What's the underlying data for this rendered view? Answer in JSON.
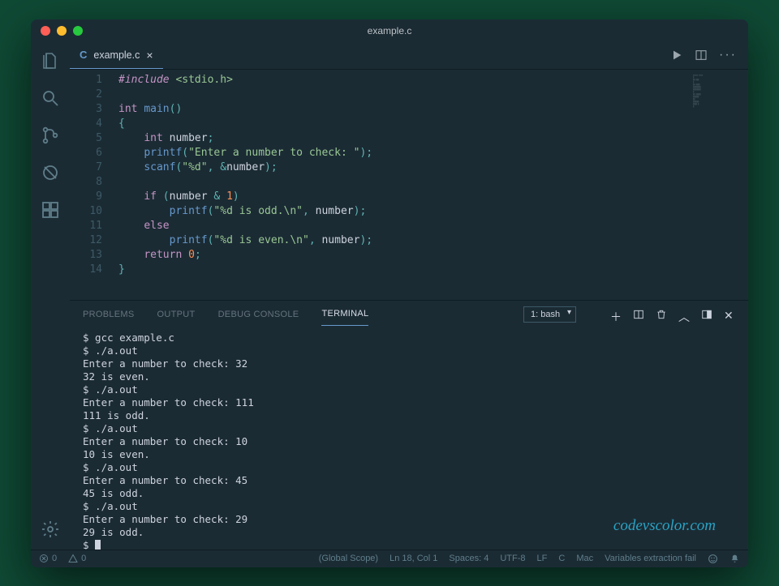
{
  "window": {
    "title": "example.c"
  },
  "tab": {
    "filename": "example.c",
    "lang_badge": "C"
  },
  "code": {
    "lines": [
      {
        "n": 1,
        "html": "<span class='tok-preproc'>#include</span> <span class='tok-include'>&lt;stdio.h&gt;</span>"
      },
      {
        "n": 2,
        "html": ""
      },
      {
        "n": 3,
        "html": "<span class='tok-type'>int</span> <span class='tok-func'>main</span><span class='tok-punc'>()</span>"
      },
      {
        "n": 4,
        "html": "<span class='tok-punc'>{</span>"
      },
      {
        "n": 5,
        "html": "    <span class='tok-type'>int</span> <span class='tok-id'>number</span><span class='tok-punc'>;</span>"
      },
      {
        "n": 6,
        "html": "    <span class='tok-func'>printf</span><span class='tok-punc'>(</span><span class='tok-str'>\"Enter a number to check: \"</span><span class='tok-punc'>);</span>"
      },
      {
        "n": 7,
        "html": "    <span class='tok-func'>scanf</span><span class='tok-punc'>(</span><span class='tok-str'>\"%d\"</span><span class='tok-punc'>,</span> <span class='tok-punc'>&amp;</span><span class='tok-id'>number</span><span class='tok-punc'>);</span>"
      },
      {
        "n": 8,
        "html": ""
      },
      {
        "n": 9,
        "html": "    <span class='tok-kw'>if</span> <span class='tok-punc'>(</span><span class='tok-id'>number</span> <span class='tok-punc'>&amp;</span> <span class='tok-num'>1</span><span class='tok-punc'>)</span>"
      },
      {
        "n": 10,
        "html": "        <span class='tok-func'>printf</span><span class='tok-punc'>(</span><span class='tok-str'>\"%d is odd.\\n\"</span><span class='tok-punc'>,</span> <span class='tok-id'>number</span><span class='tok-punc'>);</span>"
      },
      {
        "n": 11,
        "html": "    <span class='tok-kw'>else</span>"
      },
      {
        "n": 12,
        "html": "        <span class='tok-func'>printf</span><span class='tok-punc'>(</span><span class='tok-str'>\"%d is even.\\n\"</span><span class='tok-punc'>,</span> <span class='tok-id'>number</span><span class='tok-punc'>);</span>"
      },
      {
        "n": 13,
        "html": "    <span class='tok-kw'>return</span> <span class='tok-const'>0</span><span class='tok-punc'>;</span>"
      },
      {
        "n": 14,
        "html": "<span class='tok-punc'>}</span>"
      }
    ]
  },
  "panel": {
    "tabs": {
      "problems": "PROBLEMS",
      "output": "OUTPUT",
      "debug": "DEBUG CONSOLE",
      "terminal": "TERMINAL"
    },
    "terminal_select": "1: bash"
  },
  "terminal": {
    "lines": [
      "$ gcc example.c",
      "$ ./a.out",
      "Enter a number to check: 32",
      "32 is even.",
      "$ ./a.out",
      "Enter a number to check: 111",
      "111 is odd.",
      "$ ./a.out",
      "Enter a number to check: 10",
      "10 is even.",
      "$ ./a.out",
      "Enter a number to check: 45",
      "45 is odd.",
      "$ ./a.out",
      "Enter a number to check: 29",
      "29 is odd.",
      "$ "
    ]
  },
  "status": {
    "errors": "0",
    "warnings": "0",
    "scope": "(Global Scope)",
    "cursor": "Ln 18, Col 1",
    "spaces": "Spaces: 4",
    "encoding": "UTF-8",
    "eol": "LF",
    "lang": "C",
    "os": "Mac",
    "extra": "Variables extraction fail"
  },
  "watermark": "codevscolor.com"
}
